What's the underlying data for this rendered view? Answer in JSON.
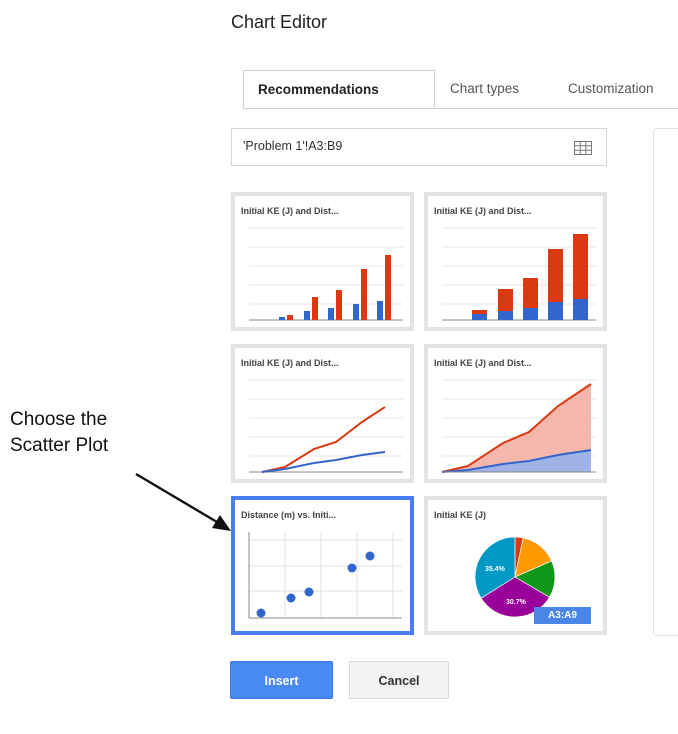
{
  "dialog": {
    "title": "Chart Editor"
  },
  "tabs": [
    {
      "label": "Recommendations",
      "active": true
    },
    {
      "label": "Chart types",
      "active": false
    },
    {
      "label": "Customization",
      "active": false
    }
  ],
  "range_field": {
    "value": "'Problem 1'!A3:B9",
    "icon": "grid-icon"
  },
  "thumbnails": [
    {
      "title": "Initial KE (J) and Dist...",
      "kind": "column",
      "selected": false
    },
    {
      "title": "Initial KE (J) and Dist...",
      "kind": "stacked-column",
      "selected": false
    },
    {
      "title": "Initial KE (J) and Dist...",
      "kind": "line",
      "selected": false
    },
    {
      "title": "Initial KE (J) and Dist...",
      "kind": "area",
      "selected": false
    },
    {
      "title": "Distance (m) vs. Initi...",
      "kind": "scatter",
      "selected": true
    },
    {
      "title": "Initial KE (J)",
      "kind": "pie",
      "selected": false,
      "pie_labels": [
        "35.4%",
        "30.7%"
      ],
      "range_badge": "A3:A9"
    }
  ],
  "buttons": {
    "insert": "Insert",
    "cancel": "Cancel"
  },
  "annotation": {
    "line1": "Choose the",
    "line2": "Scatter Plot"
  },
  "colors": {
    "red": "#dc3912",
    "blue": "#3366cc",
    "selected_border": "#4a7cf6",
    "insert_bg": "#4a8af4"
  }
}
